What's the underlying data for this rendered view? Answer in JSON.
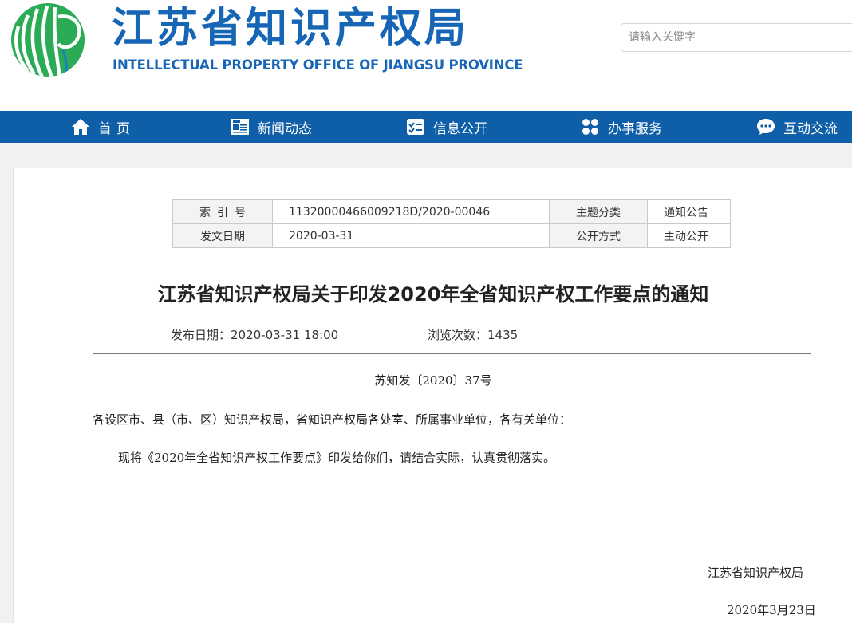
{
  "header": {
    "title": "江苏省知识产权局",
    "subtitle": "INTELLECTUAL PROPERTY OFFICE OF JIANGSU PROVINCE",
    "search_placeholder": "请输入关键字"
  },
  "nav": {
    "items": [
      {
        "label": "首页",
        "icon": "home-icon"
      },
      {
        "label": "新闻动态",
        "icon": "newspaper-icon"
      },
      {
        "label": "信息公开",
        "icon": "checklist-icon"
      },
      {
        "label": "办事服务",
        "icon": "grid-icon"
      },
      {
        "label": "互动交流",
        "icon": "chat-icon"
      }
    ]
  },
  "meta": {
    "index_label": "索引号",
    "index_value": "11320000466009218D/2020-00046",
    "category_label": "主题分类",
    "category_value": "通知公告",
    "date_label": "发文日期",
    "date_value": "2020-03-31",
    "mode_label": "公开方式",
    "mode_value": "主动公开"
  },
  "article": {
    "title": "江苏省知识产权局关于印发2020年全省知识产权工作要点的通知",
    "publish_date": "发布日期：2020-03-31 18:00",
    "views": "浏览次数：1435",
    "doc_number": "苏知发〔2020〕37号",
    "salutation": "各设区市、县（市、区）知识产权局，省知识产权局各处室、所属事业单位，各有关单位：",
    "paragraph": "现将《2020年全省知识产权工作要点》印发给你们，请结合实际，认真贯彻落实。",
    "signature": "江苏省知识产权局",
    "sign_date": "2020年3月23日"
  },
  "colors": {
    "brand_blue": "#1766b6",
    "nav_blue": "#0f5ea8",
    "logo_green": "#2db24a"
  }
}
